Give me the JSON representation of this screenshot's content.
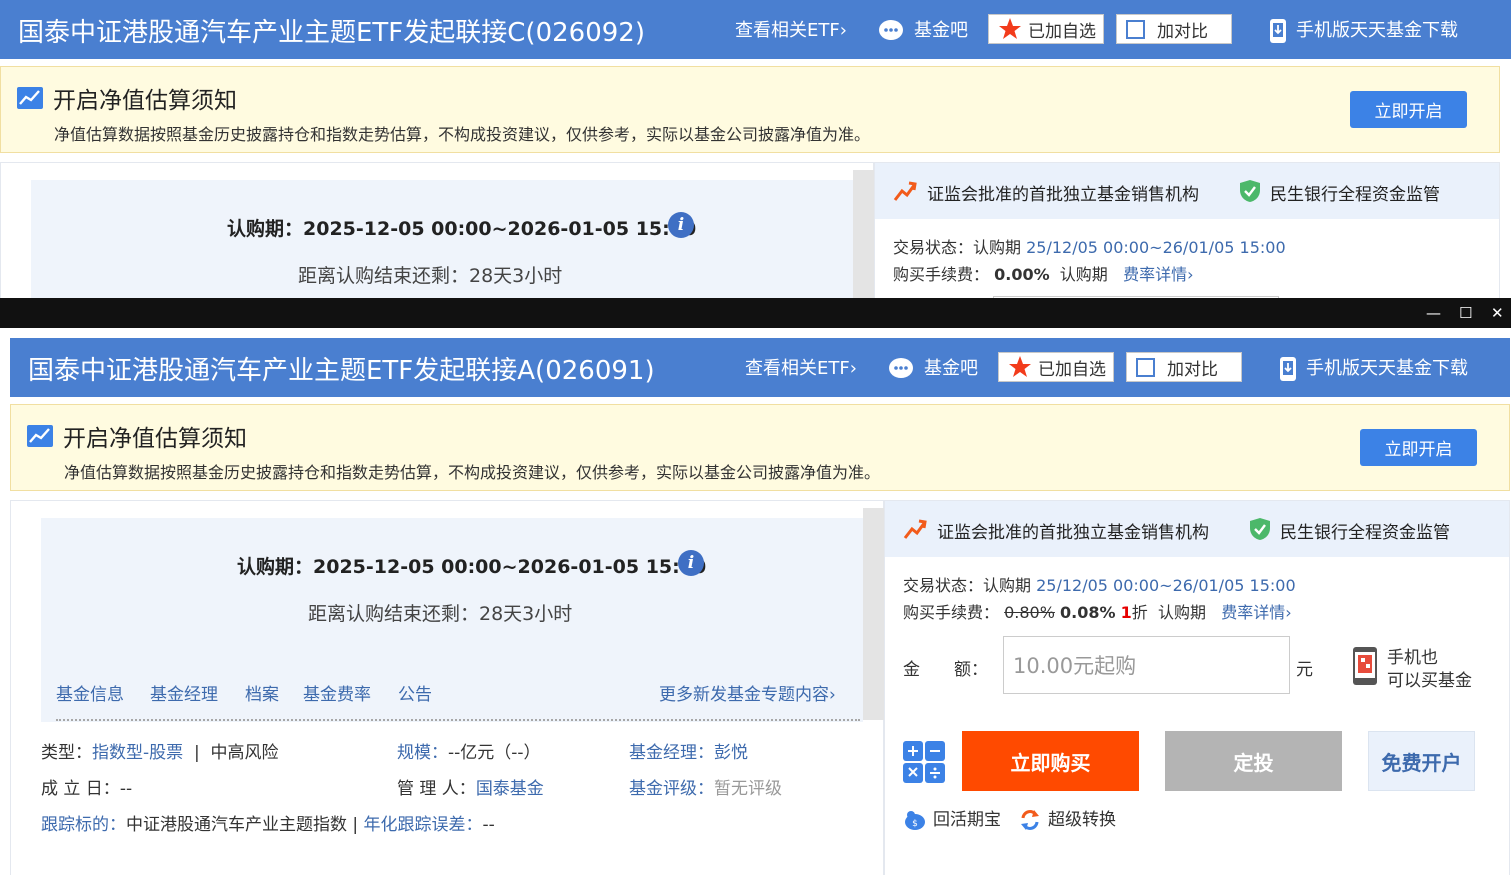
{
  "window_back": {
    "fund_title": "国泰中证港股通汽车产业主题ETF发起联接C(026092)",
    "links": {
      "etf": "查看相关ETF",
      "bar": "基金吧",
      "fav": "已加自选",
      "compare": "加对比",
      "mobile": "手机版天天基金下载"
    },
    "notice": {
      "title": "开启净值估算须知",
      "desc": "净值估算数据按照基金历史披露持仓和指数走势估算，不构成投资建议，仅供参考，实际以基金公司披露净值为准。",
      "button": "立即开启"
    },
    "period": "认购期：2025-12-05 00:00~2026-01-05 15:00",
    "remain": "距离认购结束还剩：28天3小时",
    "trust": {
      "csrc": "证监会批准的首批独立基金销售机构",
      "bank": "民生银行全程资金监管"
    },
    "status_label": "交易状态：认购期",
    "status_value": "25/12/05 00:00~26/01/05 15:00",
    "fee_label": "购买手续费：",
    "fee_value": "0.00%",
    "fee_period": "认购期",
    "fee_link": "费率详情"
  },
  "titlebar": {
    "minimize": "—",
    "maximize": "☐",
    "close": "✕"
  },
  "window_front": {
    "fund_title": "国泰中证港股通汽车产业主题ETF发起联接A(026091)",
    "links": {
      "etf": "查看相关ETF",
      "bar": "基金吧",
      "fav": "已加自选",
      "compare": "加对比",
      "mobile": "手机版天天基金下载"
    },
    "notice": {
      "title": "开启净值估算须知",
      "desc": "净值估算数据按照基金历史披露持仓和指数走势估算，不构成投资建议，仅供参考，实际以基金公司披露净值为准。",
      "button": "立即开启"
    },
    "period": "认购期：2025-12-05 00:00~2026-01-05 15:00",
    "remain": "距离认购结束还剩：28天3小时",
    "tabs": [
      "基金信息",
      "基金经理",
      "档案",
      "基金费率",
      "公告"
    ],
    "more_link": "更多新发基金专题内容",
    "info": {
      "type_label": "类型：",
      "type_value": "指数型-股票",
      "risk": "中高风险",
      "scale_label": "规模：",
      "scale_value": "--亿元（--）",
      "manager_label": "基金经理：",
      "manager_value": "彭悦",
      "setup_label": "成 立 日：",
      "setup_value": "--",
      "admin_label": "管 理 人：",
      "admin_value": "国泰基金",
      "rating_label": "基金评级：",
      "rating_value": "暂无评级",
      "track_label": "跟踪标的：",
      "track_value": "中证港股通汽车产业主题指数",
      "error_label": "年化跟踪误差：",
      "error_value": "--"
    },
    "trust": {
      "csrc": "证监会批准的首批独立基金销售机构",
      "bank": "民生银行全程资金监管"
    },
    "status_label": "交易状态：认购期",
    "status_value": "25/12/05 00:00~26/01/05 15:00",
    "fee_label": "购买手续费：",
    "fee_original": "0.80%",
    "fee_value": "0.08%",
    "fee_discount_num": "1",
    "fee_discount_unit": "折",
    "fee_period": "认购期",
    "fee_link": "费率详情",
    "amount_label": "金　　额：",
    "amount_placeholder": "10.00元起购",
    "amount_unit": "元",
    "mobile_tip_1": "手机也",
    "mobile_tip_2": "可以买基金",
    "buy_button": "立即购买",
    "plan_button": "定投",
    "open_button": "免费开户",
    "huoqi": "回活期宝",
    "convert": "超级转换"
  },
  "colors": {
    "header_blue": "#4a7fd0",
    "buy_orange": "#ff4a00",
    "link_blue": "#3d6aad",
    "notice_bg": "#fffbe0"
  }
}
